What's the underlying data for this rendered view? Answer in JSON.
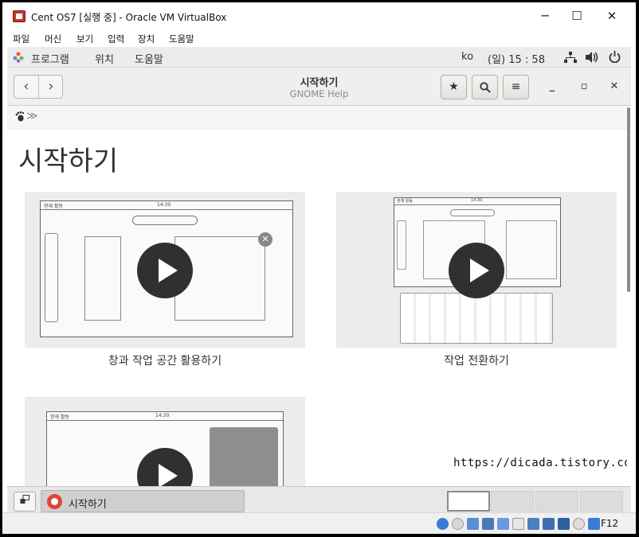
{
  "window": {
    "title": "Cent OS7 [실행 중] - Oracle VM VirtualBox",
    "controls": {
      "minimize": "─",
      "maximize": "☐",
      "close": "✕"
    }
  },
  "menubar": [
    "파일",
    "머신",
    "보기",
    "입력",
    "장치",
    "도움말"
  ],
  "gnome_topbar": {
    "programs": "프로그램",
    "places": "위치",
    "help": "도움말",
    "lang": "ko",
    "clock": "(일) 15 : 58"
  },
  "headerbar": {
    "back": "‹",
    "forward": "›",
    "title": "시작하기",
    "subtitle": "GNOME Help",
    "bookmark_icon": "★",
    "search_icon": "⚲",
    "menu_icon": "≡",
    "win_min": "_",
    "win_max": "▫",
    "win_close": "✕"
  },
  "breadcrumb": {
    "home_icon": "foot-icon",
    "separator": "≫"
  },
  "page": {
    "title": "시작하기",
    "cards": [
      {
        "caption": "창과 작업 공간 활용하기",
        "mock_label": "현재 활동",
        "mock_time": "14:30"
      },
      {
        "caption": "작업 전환하기",
        "mock_label": "현재 활동",
        "mock_time": "14:30"
      },
      {
        "caption": "",
        "mock_label": "현재 활동",
        "mock_time": "14:30"
      }
    ],
    "watermark": "https://dicada.tistory.com"
  },
  "gnome_bottombar": {
    "task_label": "시작하기"
  },
  "vbox_status": {
    "hostkey": "F12"
  },
  "colors": {
    "accent_play": "#303030",
    "lifebuoy": "#e04535",
    "vbox_icon": "#c8342c"
  }
}
